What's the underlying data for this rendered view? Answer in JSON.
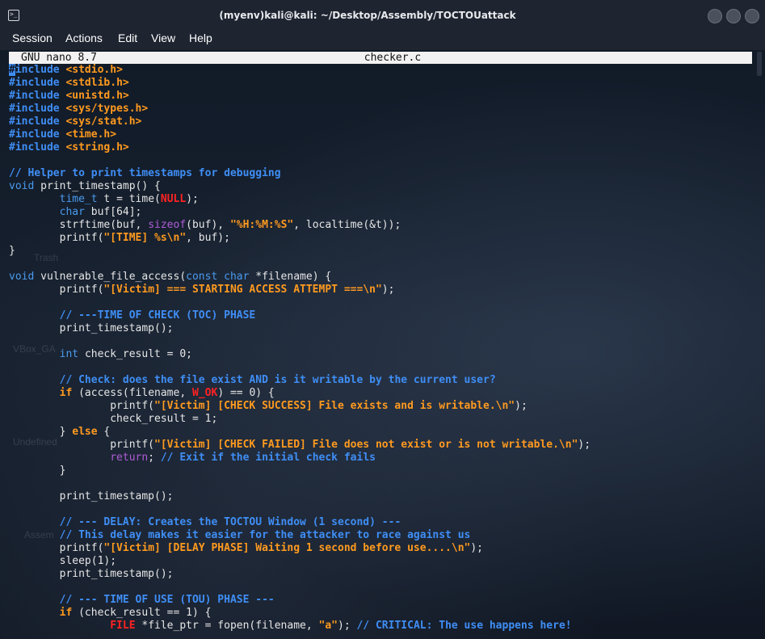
{
  "window": {
    "title": "(myenv)kali@kali: ~/Desktop/Assembly/TOCTOUattack"
  },
  "menu": {
    "items": [
      "Session",
      "Actions",
      "Edit",
      "View",
      "Help"
    ]
  },
  "nano": {
    "version": "GNU nano 8.7",
    "filename": "checker.c"
  },
  "desktop": {
    "labels": [
      "Trash",
      "VBox_GA",
      "Undefined",
      "Assem"
    ]
  },
  "code_lines": [
    [
      [
        "inc",
        "#include"
      ],
      [
        "hdr",
        " <stdio.h>"
      ]
    ],
    [
      [
        "inc",
        "#include"
      ],
      [
        "hdr",
        " <stdlib.h>"
      ]
    ],
    [
      [
        "inc",
        "#include"
      ],
      [
        "hdr",
        " <unistd.h>"
      ]
    ],
    [
      [
        "inc",
        "#include"
      ],
      [
        "hdr",
        " <sys/types.h>"
      ]
    ],
    [
      [
        "inc",
        "#include"
      ],
      [
        "hdr",
        " <sys/stat.h>"
      ]
    ],
    [
      [
        "inc",
        "#include"
      ],
      [
        "hdr",
        " <time.h>"
      ]
    ],
    [
      [
        "inc",
        "#include"
      ],
      [
        "hdr",
        " <string.h>"
      ]
    ],
    [],
    [
      [
        "cmt",
        "// Helper to print timestamps for debugging"
      ]
    ],
    [
      [
        "typ",
        "void"
      ],
      [
        "",
        "print_timestamp() {"
      ]
    ],
    [
      [
        "",
        "        "
      ],
      [
        "typ",
        "time_t"
      ],
      [
        "",
        ""
      ],
      [
        "",
        "t = time("
      ],
      [
        "red",
        "NULL"
      ],
      [
        "",
        ");"
      ]
    ],
    [
      [
        "",
        "        "
      ],
      [
        "typ",
        "char"
      ],
      [
        "",
        "buf[64];"
      ]
    ],
    [
      [
        "",
        "        strftime(buf, "
      ],
      [
        "pur",
        "sizeof"
      ],
      [
        "",
        "(buf), "
      ],
      [
        "str",
        "\"%H:%M:%S\""
      ],
      [
        "",
        ", localtime(&t));"
      ]
    ],
    [
      [
        "",
        "        printf("
      ],
      [
        "str",
        "\"[TIME] %s\\n\""
      ],
      [
        "",
        ", buf);"
      ]
    ],
    [
      [
        "",
        "}"
      ]
    ],
    [],
    [
      [
        "typ",
        "void"
      ],
      [
        "",
        "vulnerable_file_access("
      ],
      [
        "typ",
        "const char"
      ],
      [
        "",
        "*filename) {"
      ]
    ],
    [
      [
        "",
        "        printf("
      ],
      [
        "str",
        "\"[Victim] === STARTING ACCESS ATTEMPT ===\\n\""
      ],
      [
        "",
        ");"
      ]
    ],
    [],
    [
      [
        "",
        "        "
      ],
      [
        "cmt",
        "// ---TIME OF CHECK (TOC) PHASE"
      ]
    ],
    [
      [
        "",
        "        print_timestamp();"
      ]
    ],
    [],
    [
      [
        "",
        "        "
      ],
      [
        "typ",
        "int"
      ],
      [
        "",
        "check_result = 0;"
      ]
    ],
    [],
    [
      [
        "",
        "        "
      ],
      [
        "cmt",
        "// Check: does the file exist AND is it writable by the current user?"
      ]
    ],
    [
      [
        "",
        "        "
      ],
      [
        "kw",
        "if"
      ],
      [
        "",
        " (access(filename, "
      ],
      [
        "red",
        "W_OK"
      ],
      [
        "",
        ") == 0) {"
      ]
    ],
    [
      [
        "",
        "                printf("
      ],
      [
        "str",
        "\"[Victim] [CHECK SUCCESS] File exists and is writable.\\n\""
      ],
      [
        "",
        ");"
      ]
    ],
    [
      [
        "",
        "                check_result = 1;"
      ]
    ],
    [
      [
        "",
        "        } "
      ],
      [
        "kw",
        "else"
      ],
      [
        "",
        ""
      ],
      [
        "",
        " {"
      ]
    ],
    [
      [
        "",
        "                printf("
      ],
      [
        "str",
        "\"[Victim] [CHECK FAILED] File does not exist or is not writable.\\n\""
      ],
      [
        "",
        ");"
      ]
    ],
    [
      [
        "",
        "                "
      ],
      [
        "pur",
        "return"
      ],
      [
        "",
        "; "
      ],
      [
        "cmt",
        "// Exit if the initial check fails"
      ]
    ],
    [
      [
        "",
        "        }"
      ]
    ],
    [],
    [
      [
        "",
        "        print_timestamp();"
      ]
    ],
    [],
    [
      [
        "",
        "        "
      ],
      [
        "cmt",
        "// --- DELAY: Creates the TOCTOU Window (1 second) ---"
      ]
    ],
    [
      [
        "",
        "        "
      ],
      [
        "cmt",
        "// This delay makes it easier for the attacker to race against us"
      ]
    ],
    [
      [
        "",
        "        printf("
      ],
      [
        "str",
        "\"[Victim] [DELAY PHASE] Waiting 1 second before use....\\n\""
      ],
      [
        "",
        ");"
      ]
    ],
    [
      [
        "",
        "        sleep(1);"
      ]
    ],
    [
      [
        "",
        "        print_timestamp();"
      ]
    ],
    [],
    [
      [
        "",
        "        "
      ],
      [
        "cmt",
        "// --- TIME OF USE (TOU) PHASE ---"
      ]
    ],
    [
      [
        "",
        "        "
      ],
      [
        "kw",
        "if"
      ],
      [
        "",
        " (check_result == 1) {"
      ]
    ],
    [
      [
        "",
        "                "
      ],
      [
        "red",
        "FILE"
      ],
      [
        "",
        " *file_ptr = fopen(filename, "
      ],
      [
        "str",
        "\"a\""
      ],
      [
        "",
        "); "
      ],
      [
        "cmt",
        "// CRITICAL: The use happens here!"
      ]
    ]
  ]
}
